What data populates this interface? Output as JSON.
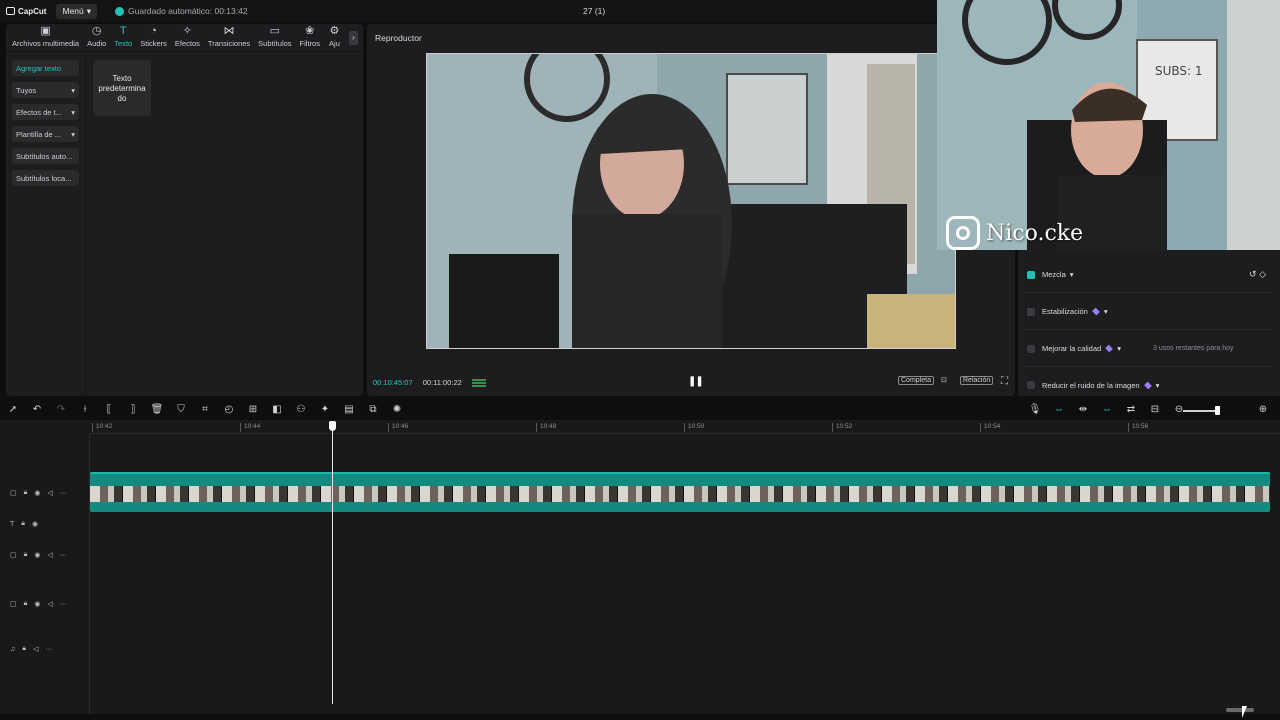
{
  "app": {
    "logo": "CapCut",
    "menu_label": "Menú",
    "autosave": "Guardado automático: 00:13:42",
    "project_title": "27 (1)"
  },
  "tabs": [
    {
      "label": "Archivos multimedia",
      "icon": "media-icon"
    },
    {
      "label": "Audio",
      "icon": "audio-icon"
    },
    {
      "label": "Texto",
      "icon": "text-icon",
      "active": true
    },
    {
      "label": "Stickers",
      "icon": "sticker-icon"
    },
    {
      "label": "Efectos",
      "icon": "effects-icon"
    },
    {
      "label": "Transiciones",
      "icon": "transitions-icon"
    },
    {
      "label": "Subtítulos",
      "icon": "subtitles-icon"
    },
    {
      "label": "Filtros",
      "icon": "filters-icon"
    },
    {
      "label": "Aju",
      "icon": "adjust-icon"
    }
  ],
  "text_categories": [
    {
      "label": "Agregar texto"
    },
    {
      "label": "Tuyos"
    },
    {
      "label": "Efectos de t..."
    },
    {
      "label": "Plantilla de ..."
    },
    {
      "label": "Subtítulos auto..."
    },
    {
      "label": "Subtítulos loca..."
    }
  ],
  "preset": {
    "label": "Texto predetermina do"
  },
  "player": {
    "title": "Reproductor",
    "current_time": "00:10:45:07",
    "total_time": "00:11:00:22",
    "full_label": "Completa",
    "ratio_label": "Relación"
  },
  "webcam": {
    "handle": "Nico.cke",
    "whiteboard": "SUBS: 1"
  },
  "properties": {
    "blend": "Mezcla",
    "stabilization": "Estabilización",
    "enhance": "Mejorar la calidad",
    "enhance_note": "3 usos restantes para hoy",
    "denoise": "Reducir el ruido de la imagen"
  },
  "ruler_labels": [
    "10:42",
    "10:44",
    "10:46",
    "10:48",
    "10:50",
    "10:52",
    "10:54",
    "10:56"
  ],
  "colors": {
    "accent": "#27c4b7",
    "clip": "#128a80",
    "panel": "#1d1d20",
    "background": "#0e0e10"
  }
}
